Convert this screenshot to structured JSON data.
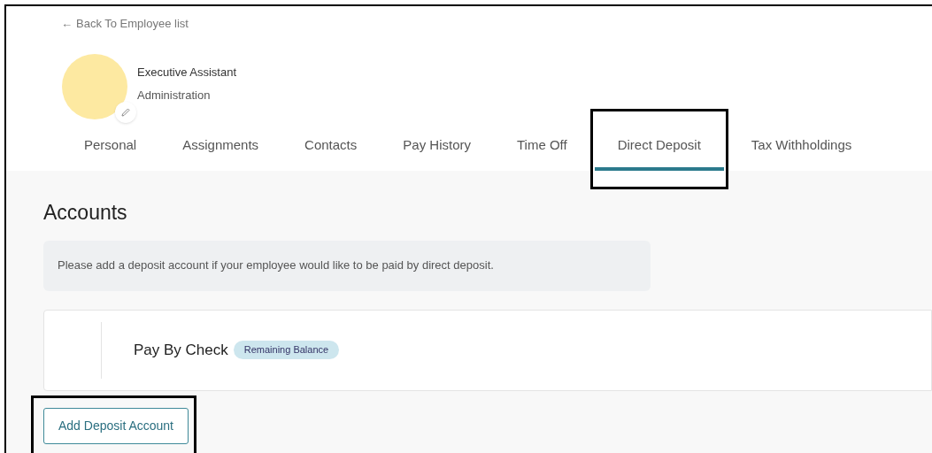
{
  "back_link": {
    "arrow": "←",
    "label": "Back To Employee list"
  },
  "employee": {
    "title": "Executive Assistant",
    "department": "Administration"
  },
  "tabs": [
    {
      "label": "Personal",
      "selected": false,
      "highlighted": false
    },
    {
      "label": "Assignments",
      "selected": false,
      "highlighted": false
    },
    {
      "label": "Contacts",
      "selected": false,
      "highlighted": false
    },
    {
      "label": "Pay History",
      "selected": false,
      "highlighted": false
    },
    {
      "label": "Time Off",
      "selected": false,
      "highlighted": false
    },
    {
      "label": "Direct Deposit",
      "selected": true,
      "highlighted": true
    },
    {
      "label": "Tax Withholdings",
      "selected": false,
      "highlighted": false
    }
  ],
  "section_title": "Accounts",
  "notice": "Please add a deposit account if your employee would like to be paid by direct deposit.",
  "accounts": [
    {
      "name": "Pay By Check",
      "badge": "Remaining Balance"
    }
  ],
  "add_button": {
    "label": "Add Deposit Account",
    "highlighted": true
  }
}
